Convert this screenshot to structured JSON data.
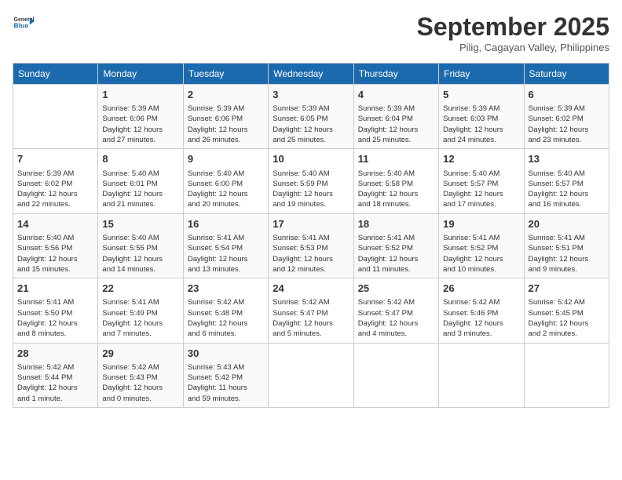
{
  "header": {
    "logo_line1": "General",
    "logo_line2": "Blue",
    "month": "September 2025",
    "location": "Pilig, Cagayan Valley, Philippines"
  },
  "days_of_week": [
    "Sunday",
    "Monday",
    "Tuesday",
    "Wednesday",
    "Thursday",
    "Friday",
    "Saturday"
  ],
  "weeks": [
    [
      {
        "day": "",
        "info": ""
      },
      {
        "day": "1",
        "info": "Sunrise: 5:39 AM\nSunset: 6:06 PM\nDaylight: 12 hours\nand 27 minutes."
      },
      {
        "day": "2",
        "info": "Sunrise: 5:39 AM\nSunset: 6:06 PM\nDaylight: 12 hours\nand 26 minutes."
      },
      {
        "day": "3",
        "info": "Sunrise: 5:39 AM\nSunset: 6:05 PM\nDaylight: 12 hours\nand 25 minutes."
      },
      {
        "day": "4",
        "info": "Sunrise: 5:39 AM\nSunset: 6:04 PM\nDaylight: 12 hours\nand 25 minutes."
      },
      {
        "day": "5",
        "info": "Sunrise: 5:39 AM\nSunset: 6:03 PM\nDaylight: 12 hours\nand 24 minutes."
      },
      {
        "day": "6",
        "info": "Sunrise: 5:39 AM\nSunset: 6:02 PM\nDaylight: 12 hours\nand 23 minutes."
      }
    ],
    [
      {
        "day": "7",
        "info": ""
      },
      {
        "day": "8",
        "info": "Sunrise: 5:40 AM\nSunset: 6:01 PM\nDaylight: 12 hours\nand 21 minutes."
      },
      {
        "day": "9",
        "info": "Sunrise: 5:40 AM\nSunset: 6:00 PM\nDaylight: 12 hours\nand 20 minutes."
      },
      {
        "day": "10",
        "info": "Sunrise: 5:40 AM\nSunset: 5:59 PM\nDaylight: 12 hours\nand 19 minutes."
      },
      {
        "day": "11",
        "info": "Sunrise: 5:40 AM\nSunset: 5:58 PM\nDaylight: 12 hours\nand 18 minutes."
      },
      {
        "day": "12",
        "info": "Sunrise: 5:40 AM\nSunset: 5:57 PM\nDaylight: 12 hours\nand 17 minutes."
      },
      {
        "day": "13",
        "info": "Sunrise: 5:40 AM\nSunset: 5:57 PM\nDaylight: 12 hours\nand 16 minutes."
      }
    ],
    [
      {
        "day": "14",
        "info": "Sunrise: 5:40 AM\nSunset: 5:56 PM\nDaylight: 12 hours\nand 15 minutes."
      },
      {
        "day": "15",
        "info": "Sunrise: 5:40 AM\nSunset: 5:55 PM\nDaylight: 12 hours\nand 14 minutes."
      },
      {
        "day": "16",
        "info": "Sunrise: 5:41 AM\nSunset: 5:54 PM\nDaylight: 12 hours\nand 13 minutes."
      },
      {
        "day": "17",
        "info": "Sunrise: 5:41 AM\nSunset: 5:53 PM\nDaylight: 12 hours\nand 12 minutes."
      },
      {
        "day": "18",
        "info": "Sunrise: 5:41 AM\nSunset: 5:52 PM\nDaylight: 12 hours\nand 11 minutes."
      },
      {
        "day": "19",
        "info": "Sunrise: 5:41 AM\nSunset: 5:52 PM\nDaylight: 12 hours\nand 10 minutes."
      },
      {
        "day": "20",
        "info": "Sunrise: 5:41 AM\nSunset: 5:51 PM\nDaylight: 12 hours\nand 9 minutes."
      }
    ],
    [
      {
        "day": "21",
        "info": "Sunrise: 5:41 AM\nSunset: 5:50 PM\nDaylight: 12 hours\nand 8 minutes."
      },
      {
        "day": "22",
        "info": "Sunrise: 5:41 AM\nSunset: 5:49 PM\nDaylight: 12 hours\nand 7 minutes."
      },
      {
        "day": "23",
        "info": "Sunrise: 5:42 AM\nSunset: 5:48 PM\nDaylight: 12 hours\nand 6 minutes."
      },
      {
        "day": "24",
        "info": "Sunrise: 5:42 AM\nSunset: 5:47 PM\nDaylight: 12 hours\nand 5 minutes."
      },
      {
        "day": "25",
        "info": "Sunrise: 5:42 AM\nSunset: 5:47 PM\nDaylight: 12 hours\nand 4 minutes."
      },
      {
        "day": "26",
        "info": "Sunrise: 5:42 AM\nSunset: 5:46 PM\nDaylight: 12 hours\nand 3 minutes."
      },
      {
        "day": "27",
        "info": "Sunrise: 5:42 AM\nSunset: 5:45 PM\nDaylight: 12 hours\nand 2 minutes."
      }
    ],
    [
      {
        "day": "28",
        "info": "Sunrise: 5:42 AM\nSunset: 5:44 PM\nDaylight: 12 hours\nand 1 minute."
      },
      {
        "day": "29",
        "info": "Sunrise: 5:42 AM\nSunset: 5:43 PM\nDaylight: 12 hours\nand 0 minutes."
      },
      {
        "day": "30",
        "info": "Sunrise: 5:43 AM\nSunset: 5:42 PM\nDaylight: 11 hours\nand 59 minutes."
      },
      {
        "day": "",
        "info": ""
      },
      {
        "day": "",
        "info": ""
      },
      {
        "day": "",
        "info": ""
      },
      {
        "day": "",
        "info": ""
      }
    ]
  ]
}
